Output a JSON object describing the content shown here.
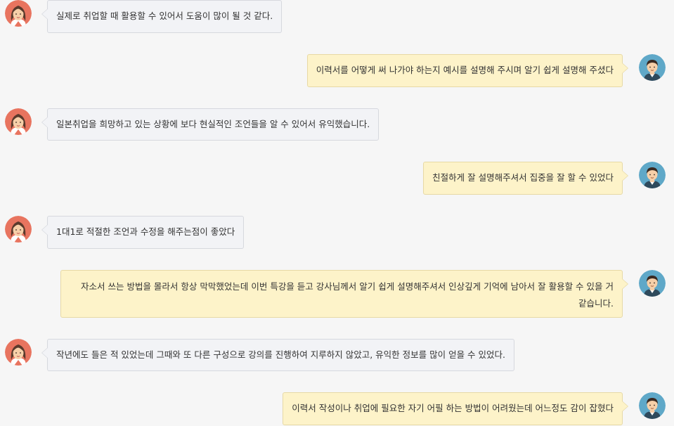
{
  "messages": [
    {
      "side": "left",
      "avatar": "female-avatar-icon",
      "text": "실제로 취업할 때 활용할 수 있어서 도움이 많이 될 것 같다."
    },
    {
      "side": "right",
      "avatar": "male-avatar-icon",
      "text": "이력서를 어떻게 써 나가야 하는지 예시를 설명해 주시며 알기 쉽게 설명해 주셨다"
    },
    {
      "side": "left",
      "avatar": "female-avatar-icon",
      "text": "일본취업을 희망하고 있는 상황에 보다 현실적인 조언들을 알 수 있어서 유익했습니다."
    },
    {
      "side": "right",
      "avatar": "male-avatar-icon",
      "text": "친절하게 잘 설명해주셔서 집중을 잘 할 수 있었다"
    },
    {
      "side": "left",
      "avatar": "female-avatar-icon",
      "text": "1대1로 적절한 조언과 수정을 해주는점이 좋았다"
    },
    {
      "side": "right",
      "avatar": "male-avatar-icon",
      "text": "자소서 쓰는 방법을 몰라서 항상 막막했었는데 이번 특강을 듣고 강사님께서 알기 쉽게 설명해주셔서 인상깊게 기억에 남아서 잘 활용할 수 있을 거 같습니다."
    },
    {
      "side": "left",
      "avatar": "female-avatar-icon",
      "text": "작년에도 들은 적 있었는데 그때와 또 다른 구성으로 강의를 진행하여 지루하지 않았고, 유익한 정보를 많이 얻을 수 있었다."
    },
    {
      "side": "right",
      "avatar": "male-avatar-icon",
      "text": "이력서 작성이나 취업에 필요한 자기 어필 하는 방법이 어려웠는데 어느정도 감이 잡혔다"
    }
  ],
  "colors": {
    "background": "#f6f6f6",
    "left_bubble": "#f2f3f6",
    "right_bubble": "#fdf3c9",
    "female_avatar_bg": "#e8745f",
    "male_avatar_bg": "#5fa8c8"
  }
}
